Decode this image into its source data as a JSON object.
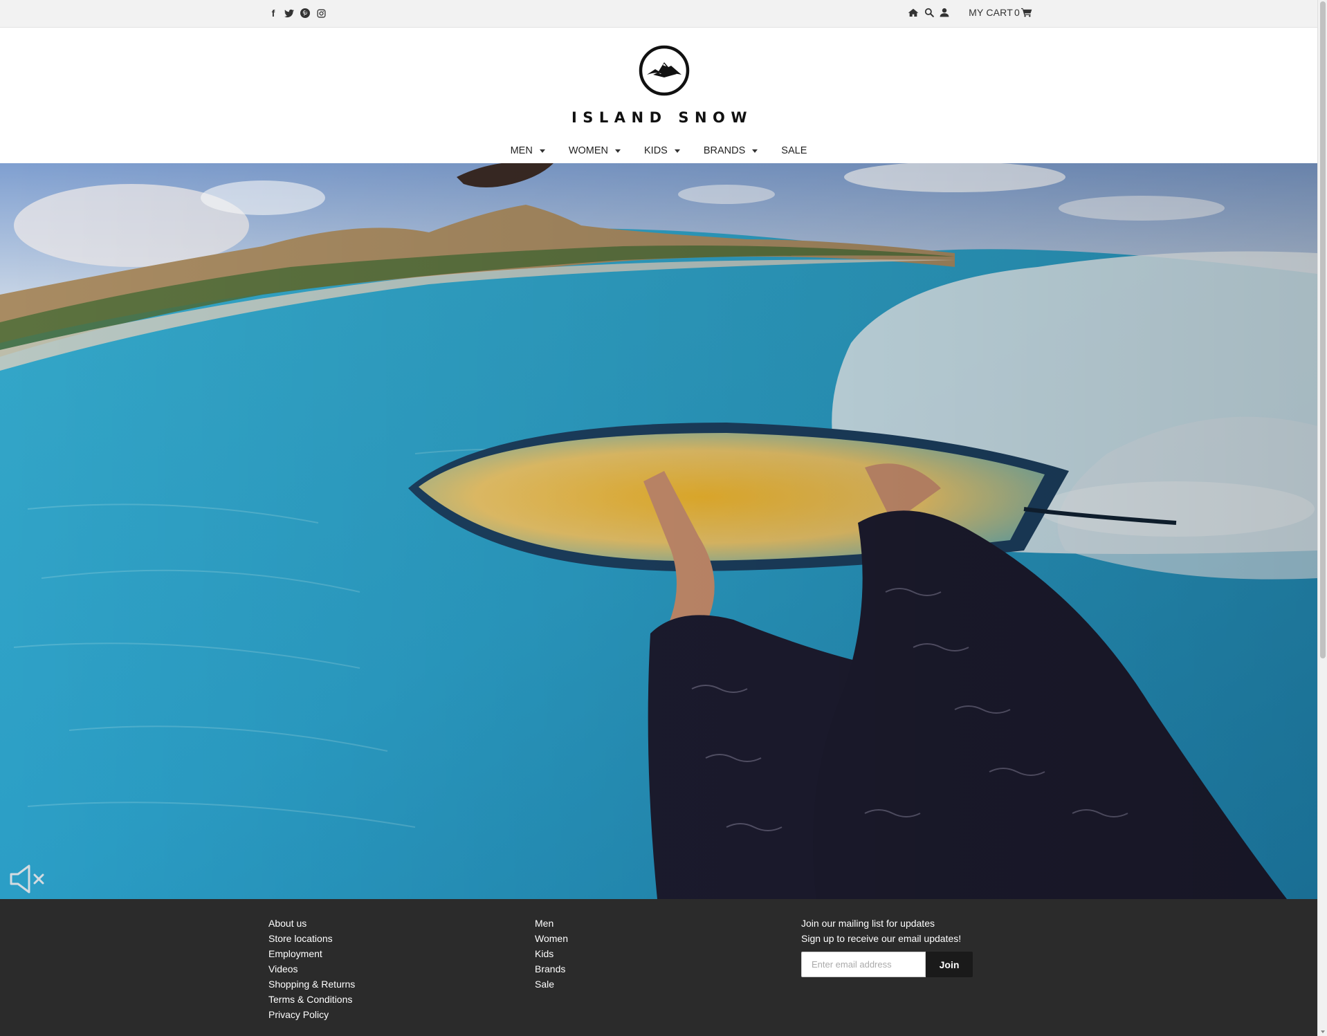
{
  "topbar": {
    "social_icons": [
      "facebook-icon",
      "twitter-icon",
      "pinterest-icon",
      "instagram-icon"
    ],
    "facebook_glyph": "f",
    "cart_label": "MY CART",
    "cart_count": "0"
  },
  "header": {
    "brand_name": "ISLAND SNOW"
  },
  "nav": {
    "items": [
      {
        "label": "MEN",
        "has_dropdown": true
      },
      {
        "label": "WOMEN",
        "has_dropdown": true
      },
      {
        "label": "KIDS",
        "has_dropdown": true
      },
      {
        "label": "BRANDS",
        "has_dropdown": true
      },
      {
        "label": "SALE",
        "has_dropdown": false
      }
    ]
  },
  "hero": {
    "muted": true
  },
  "footer": {
    "col1": [
      "About us",
      "Store locations",
      "Employment",
      "Videos",
      "Shopping & Returns",
      "Terms & Conditions",
      "Privacy Policy"
    ],
    "col2": [
      "Men",
      "Women",
      "Kids",
      "Brands",
      "Sale"
    ],
    "newsletter": {
      "title": "Join our mailing list for updates",
      "subtitle": "Sign up to receive our email updates!",
      "placeholder": "Enter email address",
      "button_label": "Join"
    }
  },
  "colors": {
    "topbar_bg": "#f2f2f2",
    "footer_bg": "#2b2b2b",
    "join_button_bg": "#1a1a1a",
    "water": "#2aa7c9"
  }
}
